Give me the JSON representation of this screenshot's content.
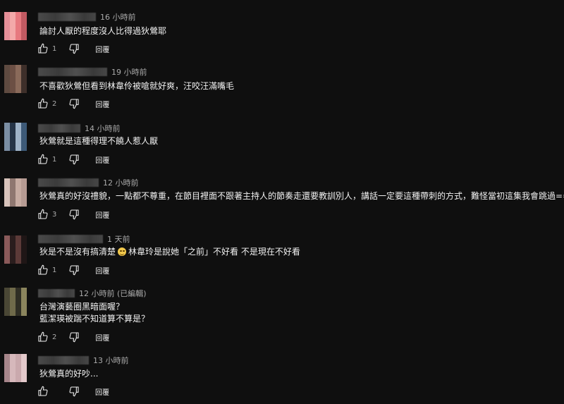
{
  "comments": [
    {
      "time": "16 小時前",
      "text": "論討人厭的程度沒人比得過狄鶯耶",
      "likes": "1",
      "reply": "回覆",
      "avatar_colors": [
        "#e58f98",
        "#f3a9a9",
        "#e7797f",
        "#c25a62"
      ]
    },
    {
      "time": "19 小時前",
      "text": "不喜歡狄鶯但看到林韋伶被嗆就好爽，汪咬汪滿嘴毛",
      "likes": "2",
      "reply": "回覆",
      "avatar_colors": [
        "#6c4f44",
        "#8a6a5a",
        "#3e2f2a",
        "#5e4a40"
      ]
    },
    {
      "time": "14 小時前",
      "text": "狄鶯就是這種得理不饒人惹人厭",
      "likes": "1",
      "reply": "回覆",
      "avatar_colors": [
        "#9fb3c8",
        "#3d5a78",
        "#7b8ea3",
        "#253447"
      ]
    },
    {
      "time": "12 小時前",
      "text": "狄鶯真的好沒禮貌，一點都不尊重，在節目裡面不跟著主持人的節奏走還要教訓別人，講話一定要這種帶刺的方式，難怪當初這集我會跳過==",
      "likes": "3",
      "reply": "回覆",
      "avatar_colors": [
        "#b69b93",
        "#d8c3bb",
        "#8f7770",
        "#c7aca2"
      ]
    },
    {
      "time": "1 天前",
      "text_a": "狄是不是沒有搞清楚",
      "text_b": "林韋玲是說她「之前」不好看 不是現在不好看",
      "emoji": "smiling-face",
      "likes": "1",
      "reply": "回覆",
      "avatar_colors": [
        "#8a5a5a",
        "#2a1d1d",
        "#5c3a38",
        "#1f1616"
      ]
    },
    {
      "time": "12 小時前 (已編輯)",
      "lines": [
        "台灣演藝圈黑暗面喔？",
        "藍潔瑛被踹不知道算不算是？"
      ],
      "likes": "2",
      "reply": "回覆",
      "avatar_colors": [
        "#6f6a4a",
        "#2f2e24",
        "#8b855d",
        "#4a4735"
      ]
    },
    {
      "time": "13 小時前",
      "text": "狄鶯真的好吵...",
      "likes": "",
      "reply": "回覆",
      "avatar_colors": [
        "#caa9ad",
        "#e3c9cb",
        "#a7868b",
        "#d6b8bb"
      ]
    }
  ]
}
